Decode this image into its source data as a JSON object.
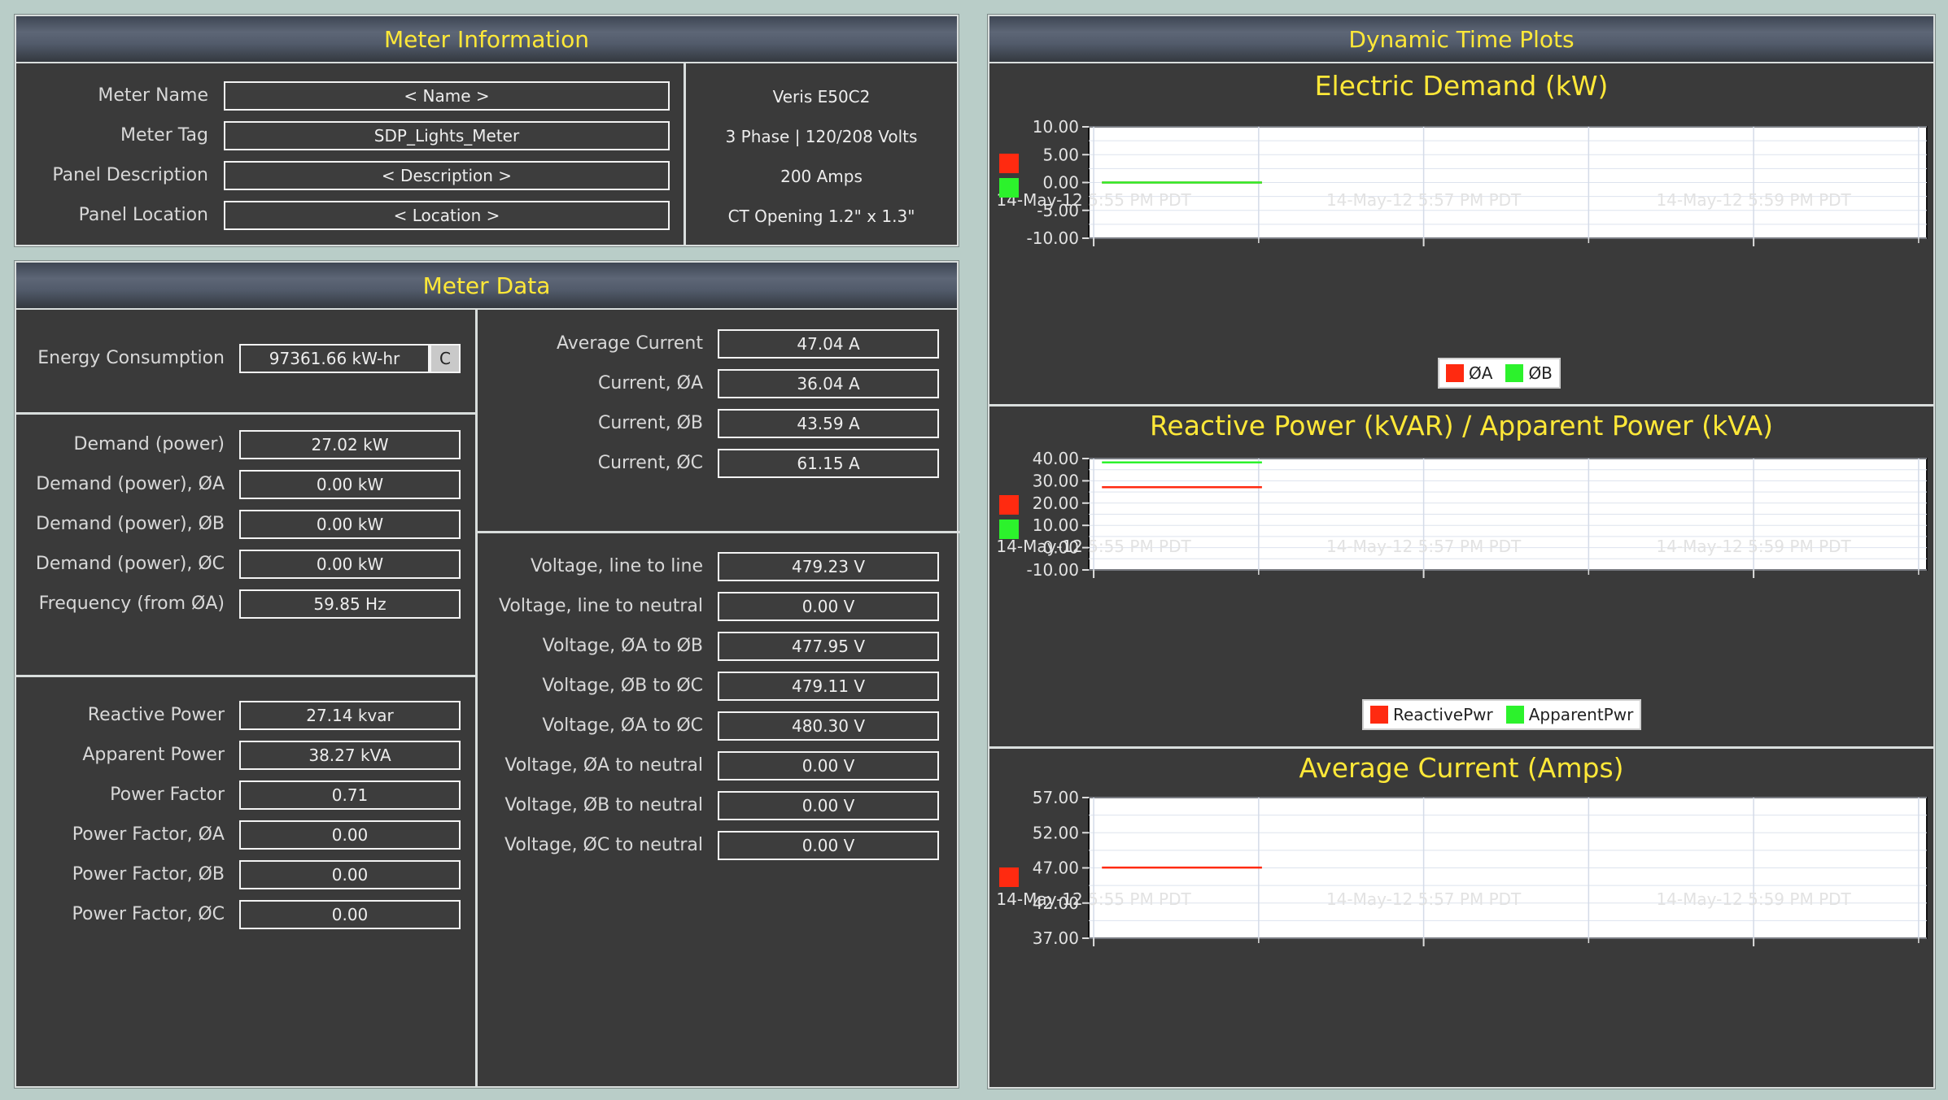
{
  "meter_info": {
    "title": "Meter Information",
    "fields": [
      {
        "label": "Meter Name",
        "value": "< Name >"
      },
      {
        "label": "Meter Tag",
        "value": "SDP_Lights_Meter"
      },
      {
        "label": "Panel Description",
        "value": "< Description >"
      },
      {
        "label": "Panel Location",
        "value": "< Location >"
      }
    ],
    "specs": [
      "Veris E50C2",
      "3 Phase | 120/208 Volts",
      "200 Amps",
      "CT Opening 1.2\" x 1.3\""
    ]
  },
  "meter_data": {
    "title": "Meter Data",
    "energy": {
      "label": "Energy Consumption",
      "value": "97361.66 kW-hr",
      "button": "C"
    },
    "demand": [
      {
        "label": "Demand (power)",
        "value": "27.02 kW"
      },
      {
        "label": "Demand (power), ØA",
        "value": "0.00 kW"
      },
      {
        "label": "Demand (power), ØB",
        "value": "0.00 kW"
      },
      {
        "label": "Demand (power), ØC",
        "value": "0.00 kW"
      },
      {
        "label": "Frequency (from ØA)",
        "value": "59.85 Hz"
      }
    ],
    "power": [
      {
        "label": "Reactive Power",
        "value": "27.14 kvar"
      },
      {
        "label": "Apparent Power",
        "value": "38.27 kVA"
      },
      {
        "label": "Power Factor",
        "value": "0.71"
      },
      {
        "label": "Power Factor, ØA",
        "value": "0.00"
      },
      {
        "label": "Power Factor, ØB",
        "value": "0.00"
      },
      {
        "label": "Power Factor, ØC",
        "value": "0.00"
      }
    ],
    "current": [
      {
        "label": "Average Current",
        "value": "47.04 A"
      },
      {
        "label": "Current, ØA",
        "value": "36.04 A"
      },
      {
        "label": "Current, ØB",
        "value": "43.59 A"
      },
      {
        "label": "Current, ØC",
        "value": "61.15 A"
      }
    ],
    "voltage": [
      {
        "label": "Voltage, line to line",
        "value": "479.23 V"
      },
      {
        "label": "Voltage, line to neutral",
        "value": "0.00 V"
      },
      {
        "label": "Voltage, ØA to ØB",
        "value": "477.95 V"
      },
      {
        "label": "Voltage, ØB to ØC",
        "value": "479.11 V"
      },
      {
        "label": "Voltage, ØA to ØC",
        "value": "480.30 V"
      },
      {
        "label": "Voltage, ØA to neutral",
        "value": "0.00 V"
      },
      {
        "label": "Voltage, ØB to neutral",
        "value": "0.00 V"
      },
      {
        "label": "Voltage, ØC to neutral",
        "value": "0.00 V"
      }
    ]
  },
  "plots": {
    "title": "Dynamic Time Plots",
    "colors": {
      "red": "#ff2a10",
      "green": "#2cf22c"
    }
  },
  "chart_data": [
    {
      "type": "line",
      "title": "Electric Demand (kW)",
      "x_tick_labels": [
        "14-May-12 5:55 PM PDT",
        "14-May-12 5:57 PM PDT",
        "14-May-12 5:59 PM PDT"
      ],
      "y_tick_labels": [
        "10.00",
        "5.00",
        "0.00",
        "-5.00",
        "-10.00"
      ],
      "ylim": [
        -10,
        10
      ],
      "grid": true,
      "legend_position": "bottom",
      "series": [
        {
          "name": "ØA",
          "color": "#ff2a10",
          "x": [
            "14-May-12 5:55 PM PDT",
            "14-May-12 5:56 PM PDT"
          ],
          "y": [
            0.0,
            0.0
          ]
        },
        {
          "name": "ØB",
          "color": "#2cf22c",
          "x": [
            "14-May-12 5:55 PM PDT",
            "14-May-12 5:56 PM PDT"
          ],
          "y": [
            0.0,
            0.0
          ]
        }
      ]
    },
    {
      "type": "line",
      "title": "Reactive Power (kVAR) / Apparent Power (kVA)",
      "x_tick_labels": [
        "14-May-12 5:55 PM PDT",
        "14-May-12 5:57 PM PDT",
        "14-May-12 5:59 PM PDT"
      ],
      "y_tick_labels": [
        "40.00",
        "30.00",
        "20.00",
        "10.00",
        "0.00",
        "-10.00"
      ],
      "ylim": [
        -10,
        40
      ],
      "grid": true,
      "legend_position": "bottom",
      "series": [
        {
          "name": "ReactivePwr",
          "color": "#ff2a10",
          "x": [
            "14-May-12 5:55 PM PDT",
            "14-May-12 5:56 PM PDT"
          ],
          "y": [
            27.14,
            27.14
          ]
        },
        {
          "name": "ApparentPwr",
          "color": "#2cf22c",
          "x": [
            "14-May-12 5:55 PM PDT",
            "14-May-12 5:56 PM PDT"
          ],
          "y": [
            38.27,
            38.27
          ]
        }
      ]
    },
    {
      "type": "line",
      "title": "Average Current (Amps)",
      "x_tick_labels": [
        "14-May-12 5:55 PM PDT",
        "14-May-12 5:57 PM PDT",
        "14-May-12 5:59 PM PDT"
      ],
      "y_tick_labels": [
        "57.00",
        "52.00",
        "47.00",
        "42.00",
        "37.00"
      ],
      "ylim": [
        37,
        57
      ],
      "grid": true,
      "legend_position": "none",
      "series": [
        {
          "color": "#ff2a10",
          "x": [
            "14-May-12 5:55 PM PDT",
            "14-May-12 5:56 PM PDT"
          ],
          "y": [
            47.04,
            47.04
          ]
        }
      ]
    }
  ]
}
